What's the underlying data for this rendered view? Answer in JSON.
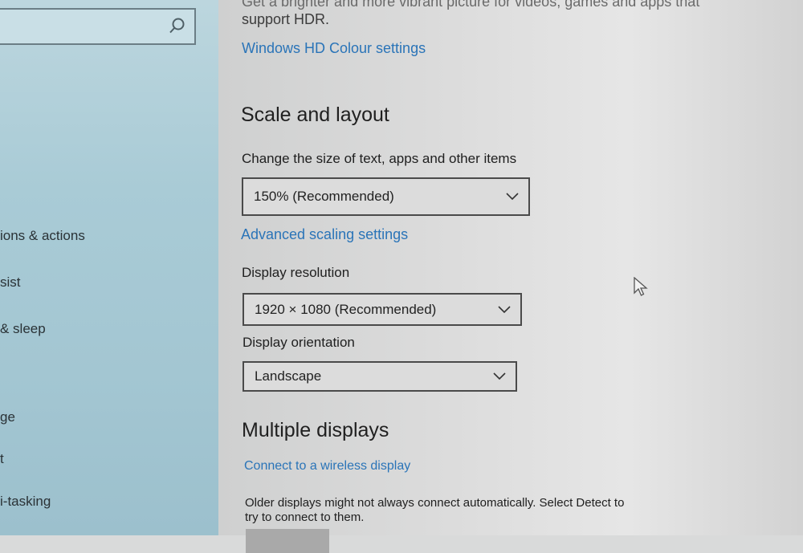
{
  "sidebar": {
    "search": {
      "value": ""
    },
    "items": [
      {
        "label": "ions & actions"
      },
      {
        "label": "sist"
      },
      {
        "label": "& sleep"
      },
      {
        "label": "ge"
      },
      {
        "label": "t"
      },
      {
        "label": "i-tasking"
      }
    ]
  },
  "hdr": {
    "description_top": "Get a brighter and more vibrant picture for videos, games and apps that",
    "description_bottom": "support HDR.",
    "link": "Windows HD Colour settings"
  },
  "scale": {
    "heading": "Scale and layout",
    "size_label": "Change the size of text, apps and other items",
    "size_value": "150% (Recommended)",
    "advanced_link": "Advanced scaling settings",
    "resolution_label": "Display resolution",
    "resolution_value": "1920 × 1080 (Recommended)",
    "orientation_label": "Display orientation",
    "orientation_value": "Landscape"
  },
  "multiple": {
    "heading": "Multiple displays",
    "wireless_link": "Connect to a wireless display",
    "desc_line1": "Older displays might not always connect automatically. Select Detect to",
    "desc_line2": "try to connect to them."
  },
  "icons": {
    "search": "search-icon",
    "dropdown": "chevron-down-icon",
    "cursor": "mouse-pointer-icon"
  },
  "colors": {
    "link": "#2a74b8",
    "sidebar": "#a9cbd6",
    "content": "#dcdcdc"
  }
}
